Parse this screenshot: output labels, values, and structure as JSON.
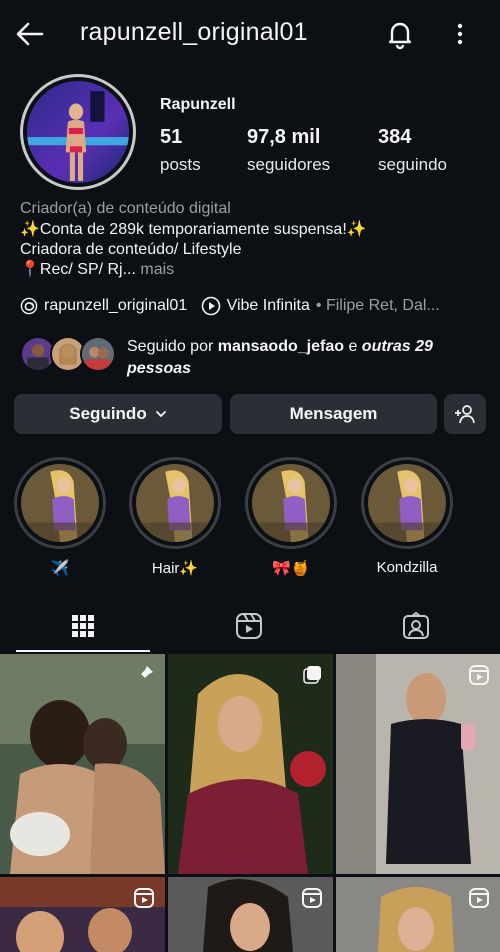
{
  "header": {
    "username": "rapunzell_original01",
    "icons": [
      "arrow-left-icon",
      "bell-icon",
      "more-vertical-icon"
    ]
  },
  "profile": {
    "display_name": "Rapunzell",
    "stats": [
      {
        "value": "51",
        "label": "posts"
      },
      {
        "value": "97,8 mil",
        "label": "seguidores"
      },
      {
        "value": "384",
        "label": "seguindo"
      }
    ],
    "category": "Criador(a) de conteúdo digital",
    "bio_lines": [
      "✨Conta de 289k temporariamente suspensa!✨",
      "Criadora de conteúdo/ Lifestyle",
      "📍Rec/ SP/ Rj..."
    ],
    "bio_more": " mais"
  },
  "links": {
    "threads_handle": "rapunzell_original01",
    "music_title": "Vibe Infinita",
    "music_artist": "• Filipe Ret, Dal..."
  },
  "followed_by": {
    "prefix": "Seguido por ",
    "user": "mansaodo_jefao",
    "conjunction": " e ",
    "others": "outras 29 pessoas"
  },
  "actions": {
    "following_label": "Seguindo",
    "message_label": "Mensagem"
  },
  "highlights": [
    {
      "label": "✈️"
    },
    {
      "label": "Hair✨"
    },
    {
      "label": "🎀🍯"
    },
    {
      "label": "Kondzilla"
    }
  ],
  "tabs": [
    "grid-icon",
    "reels-icon",
    "tagged-icon"
  ],
  "colors": {
    "background": "#0c0f14",
    "button": "#2a2f36",
    "muted_text": "#9aa0a6"
  }
}
